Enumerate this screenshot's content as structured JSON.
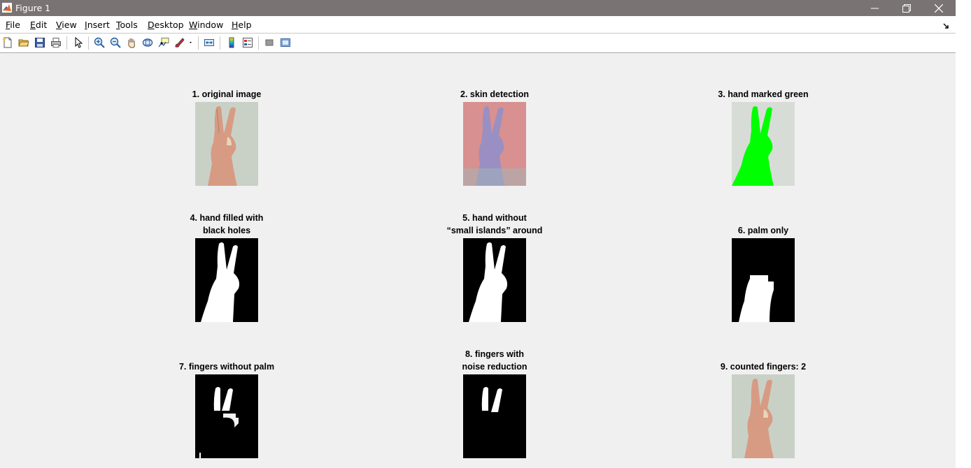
{
  "window": {
    "title": "Figure 1"
  },
  "menu": [
    {
      "key": "file",
      "mnemonic": "F",
      "rest": "ile"
    },
    {
      "key": "edit",
      "mnemonic": "E",
      "rest": "dit"
    },
    {
      "key": "view",
      "mnemonic": "V",
      "rest": "iew"
    },
    {
      "key": "insert",
      "mnemonic": "I",
      "rest": "nsert"
    },
    {
      "key": "tools",
      "mnemonic": "T",
      "rest": "ools"
    },
    {
      "key": "desktop",
      "mnemonic": "D",
      "rest": "esktop"
    },
    {
      "key": "window",
      "mnemonic": "W",
      "rest": "indow"
    },
    {
      "key": "help",
      "mnemonic": "H",
      "rest": "elp"
    }
  ],
  "toolbar": [
    "new-figure-icon",
    "open-file-icon",
    "save-icon",
    "print-icon",
    "pointer-icon",
    "zoom-in-icon",
    "zoom-out-icon",
    "pan-icon",
    "rotate-3d-icon",
    "data-cursor-icon",
    "brush-icon",
    "link-plot-icon",
    "colorbar-icon",
    "legend-icon",
    "hide-plot-tools-icon",
    "show-plot-tools-icon"
  ],
  "panels": [
    {
      "id": "p1",
      "title": [
        "1. original image"
      ],
      "kind": "photo"
    },
    {
      "id": "p2",
      "title": [
        "2. skin detection"
      ],
      "kind": "skin"
    },
    {
      "id": "p3",
      "title": [
        "3. hand marked green"
      ],
      "kind": "green"
    },
    {
      "id": "p4",
      "title": [
        "4. hand filled with",
        "black holes"
      ],
      "kind": "mask-full"
    },
    {
      "id": "p5",
      "title": [
        "5. hand without",
        "“small islands” around"
      ],
      "kind": "mask-full"
    },
    {
      "id": "p6",
      "title": [
        "6. palm only"
      ],
      "kind": "palm"
    },
    {
      "id": "p7",
      "title": [
        "7. fingers without palm"
      ],
      "kind": "fingers-raw"
    },
    {
      "id": "p8",
      "title": [
        "8. fingers with",
        "noise reduction"
      ],
      "kind": "fingers-clean"
    },
    {
      "id": "p9",
      "title": [
        "9. counted fingers: 2"
      ],
      "kind": "photo"
    }
  ],
  "colors": {
    "titlebar": "#7a7373",
    "canvas": "#f0f0f0",
    "mask_on": "#ffffff",
    "mask_off": "#000000",
    "marked": "#00ff00"
  }
}
